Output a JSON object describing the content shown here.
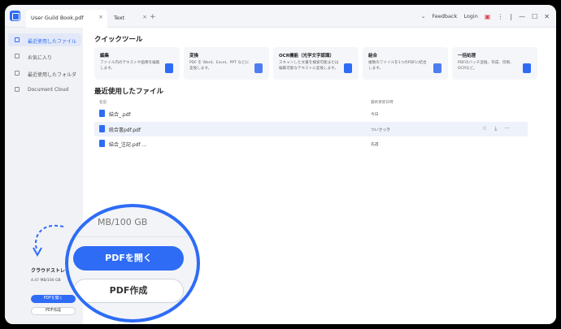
{
  "titlebar": {
    "tabs": [
      {
        "label": "User Guild Book.pdf",
        "close": "×"
      },
      {
        "label": "Text",
        "close": "×"
      }
    ],
    "new_tab": "+",
    "feedback": "Feedback",
    "login": "Login"
  },
  "sidebar": {
    "items": [
      {
        "label": "最近使用したファイル"
      },
      {
        "label": "お気に入り"
      },
      {
        "label": "最近使用したフォルダ"
      },
      {
        "label": "Document Cloud"
      }
    ],
    "cloud_label": "クラウドストレー",
    "cloud_size": "4.47 MB/100 GB",
    "open_button": "PDFを開く",
    "create_button": "PDF作成"
  },
  "quick_tools": {
    "title": "クイックツール",
    "cards": [
      {
        "title": "編集",
        "desc": "ファイル内のテキストや画像を編集します。"
      },
      {
        "title": "変換",
        "desc": "PDF を Word、Excel、PPT などに変換します。"
      },
      {
        "title": "OCR機能（光学文字認識）",
        "desc": "スキャンした文書を検索可能または編集可能なテキストに変換します。"
      },
      {
        "title": "結合",
        "desc": "複数のファイルを1つのPDFに結合します。"
      },
      {
        "title": "一括処理",
        "desc": "PDFのバッチ変換、作成、印刷、OCRなど。"
      }
    ]
  },
  "recent": {
    "title": "最近使用したファイル",
    "col_name": "名前",
    "col_date": "最終更新日時",
    "files": [
      {
        "name": "結合_.pdf",
        "date": "今日"
      },
      {
        "name": "統合書pdf.pdf",
        "date": "ついさっき"
      },
      {
        "name": "結合_注記.pdf ...",
        "date": "先週"
      }
    ]
  },
  "zoom": {
    "size": "MB/100 GB",
    "open_button": "PDFを開く",
    "create_button": "PDF作成"
  },
  "colors": {
    "accent": "#2e6cf6",
    "sidebar_bg": "#f1f2f5"
  }
}
